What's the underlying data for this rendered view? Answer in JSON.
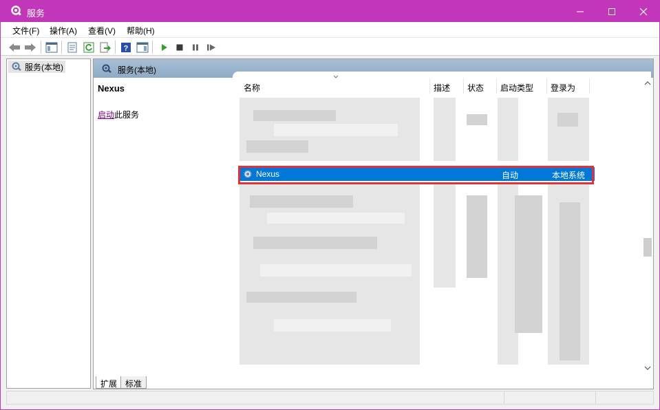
{
  "window": {
    "title": "服务",
    "accent_color": "#c236b9",
    "controls": [
      "minimize-icon",
      "maximize-icon",
      "close-icon"
    ]
  },
  "menu": {
    "items": [
      "文件(F)",
      "操作(A)",
      "查看(V)",
      "帮助(H)"
    ]
  },
  "toolbar": {
    "icons": [
      "back-icon",
      "forward-icon",
      "show-hide-tree-icon",
      "properties-icon",
      "refresh-icon",
      "export-list-icon",
      "help-icon",
      "show-action-pane-icon",
      "start-service-icon",
      "stop-service-icon",
      "pause-service-icon",
      "restart-service-icon"
    ]
  },
  "tree": {
    "selected_node": "服务(本地)"
  },
  "panel": {
    "header": "服务(本地)",
    "service_name": "Nexus",
    "start_link": "启动",
    "start_suffix": "此服务"
  },
  "table": {
    "columns": [
      "名称",
      "描述",
      "状态",
      "启动类型",
      "登录为"
    ],
    "selected_row": {
      "name": "Nexus",
      "description": "",
      "status": "",
      "startup_type": "自动",
      "logon_as": "本地系统"
    },
    "selection_color": "#0078d7",
    "highlight_color": "#e0313d"
  },
  "tabs": [
    "扩展",
    "标准"
  ]
}
